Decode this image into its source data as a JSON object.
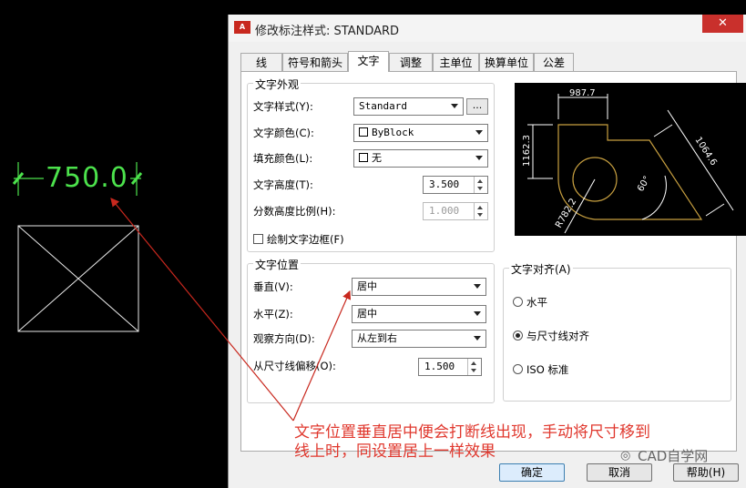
{
  "cad": {
    "dimension_value": "750.0"
  },
  "dialog": {
    "app_icon": "A",
    "title": "修改标注样式: STANDARD",
    "close": "✕",
    "tabs": [
      {
        "label": "线"
      },
      {
        "label": "符号和箭头"
      },
      {
        "label": "文字"
      },
      {
        "label": "调整"
      },
      {
        "label": "主单位"
      },
      {
        "label": "换算单位"
      },
      {
        "label": "公差"
      }
    ],
    "active_tab": "文字",
    "appearance": {
      "title": "文字外观",
      "style_label": "文字样式(Y):",
      "style_value": "Standard",
      "style_browse": "...",
      "color_label": "文字颜色(C):",
      "color_value": "ByBlock",
      "fill_label": "填充颜色(L):",
      "fill_value": "无",
      "height_label": "文字高度(T):",
      "height_value": "3.500",
      "fraction_label": "分数高度比例(H):",
      "fraction_value": "1.000",
      "frame_label": "绘制文字边框(F)",
      "frame_checked": false
    },
    "position": {
      "title": "文字位置",
      "vertical_label": "垂直(V):",
      "vertical_value": "居中",
      "horizontal_label": "水平(Z):",
      "horizontal_value": "居中",
      "view_label": "观察方向(D):",
      "view_value": "从左到右",
      "offset_label": "从尺寸线偏移(O):",
      "offset_value": "1.500"
    },
    "alignment": {
      "title": "文字对齐(A)",
      "options": [
        {
          "label": "水平",
          "selected": false
        },
        {
          "label": "与尺寸线对齐",
          "selected": true
        },
        {
          "label": "ISO 标准",
          "selected": false
        }
      ]
    },
    "preview": {
      "dim_top": "987.7",
      "dim_left": "1162.3",
      "dim_diag": "1064.6",
      "dim_angle": "60°",
      "dim_radius": "R782.2",
      "line_color": "#c8a040",
      "dim_color": "#ffffff"
    },
    "buttons": {
      "ok": "确定",
      "cancel": "取消",
      "help": "帮助(H)"
    }
  },
  "annotation": {
    "text_line1": "文字位置垂直居中便会打断线出现，手动将尺寸移到",
    "text_line2": "线上时，同设置居上一样效果",
    "color": "#e0382e"
  },
  "watermark": {
    "text": "CAD自学网",
    "icon": "wechat-icon"
  }
}
